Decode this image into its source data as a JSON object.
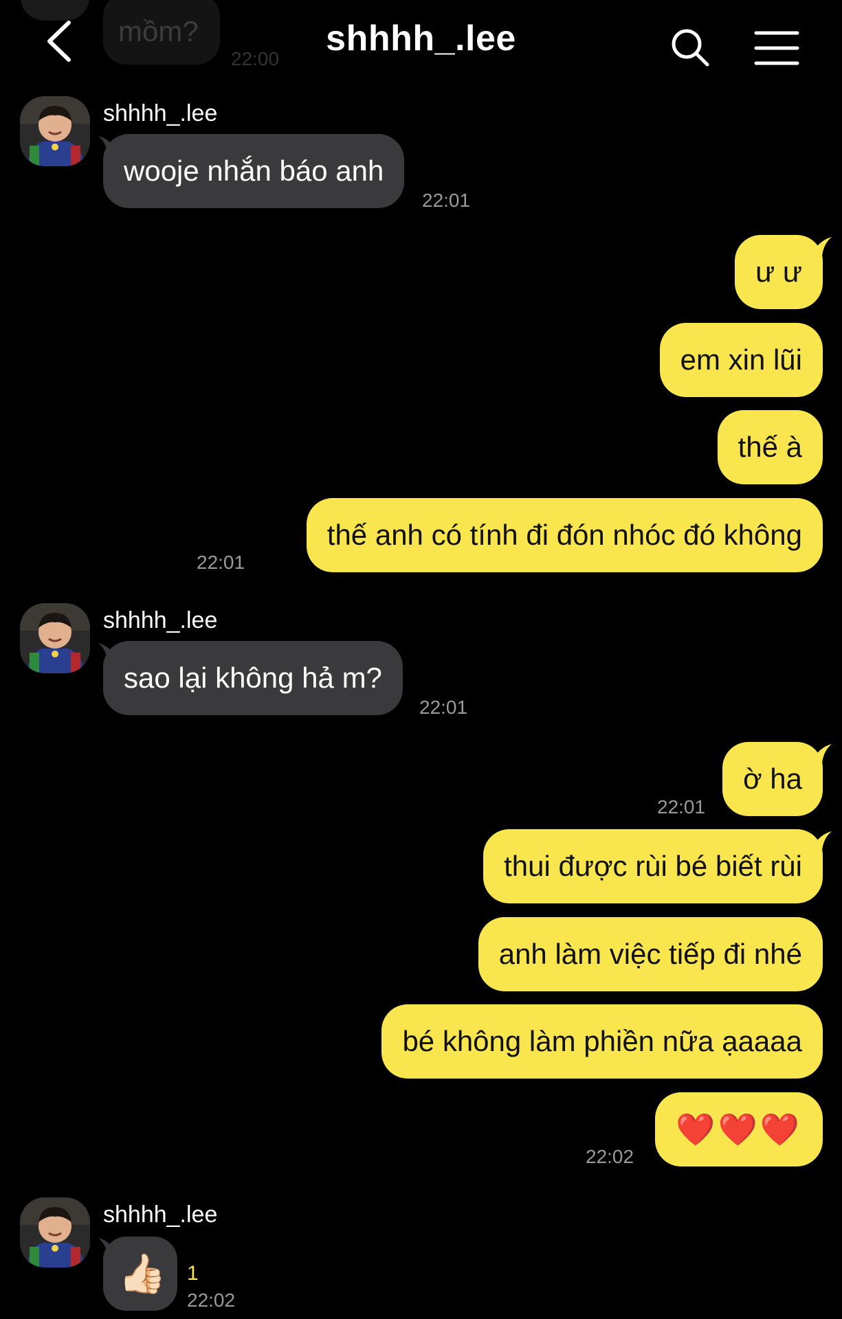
{
  "header": {
    "title": "shhhh_.lee"
  },
  "previous": {
    "text": "mồm?",
    "time": "22:00"
  },
  "messages": [
    {
      "sender": "shhhh_.lee",
      "text": "wooje nhắn báo anh",
      "time": "22:01"
    },
    {
      "text": "ư ư"
    },
    {
      "text": "em xin lũi"
    },
    {
      "text": "thế à"
    },
    {
      "text": "thế anh có tính đi đón nhóc đó không",
      "time": "22:01"
    },
    {
      "sender": "shhhh_.lee",
      "text": "sao lại không hả m?",
      "time": "22:01"
    },
    {
      "text": "ờ ha",
      "time": "22:01"
    },
    {
      "text": "thui được rùi bé biết rùi"
    },
    {
      "text": "anh làm việc tiếp đi nhé"
    },
    {
      "text": "bé không làm phiền nữa ạaaaa"
    },
    {
      "text": "❤️❤️❤️",
      "time": "22:02"
    },
    {
      "sender": "shhhh_.lee",
      "text": "👍🏻",
      "unread": "1",
      "time": "22:02"
    }
  ],
  "colors": {
    "background": "#000000",
    "incoming_bubble": "#3a3a3c",
    "outgoing_bubble": "#f9e54d",
    "timestamp": "#9a9a9a",
    "unread_count": "#f9e54d"
  },
  "icons": {
    "back": "chevron-left-icon",
    "search": "search-icon",
    "menu": "hamburger-menu-icon",
    "avatar": "profile-photo"
  }
}
